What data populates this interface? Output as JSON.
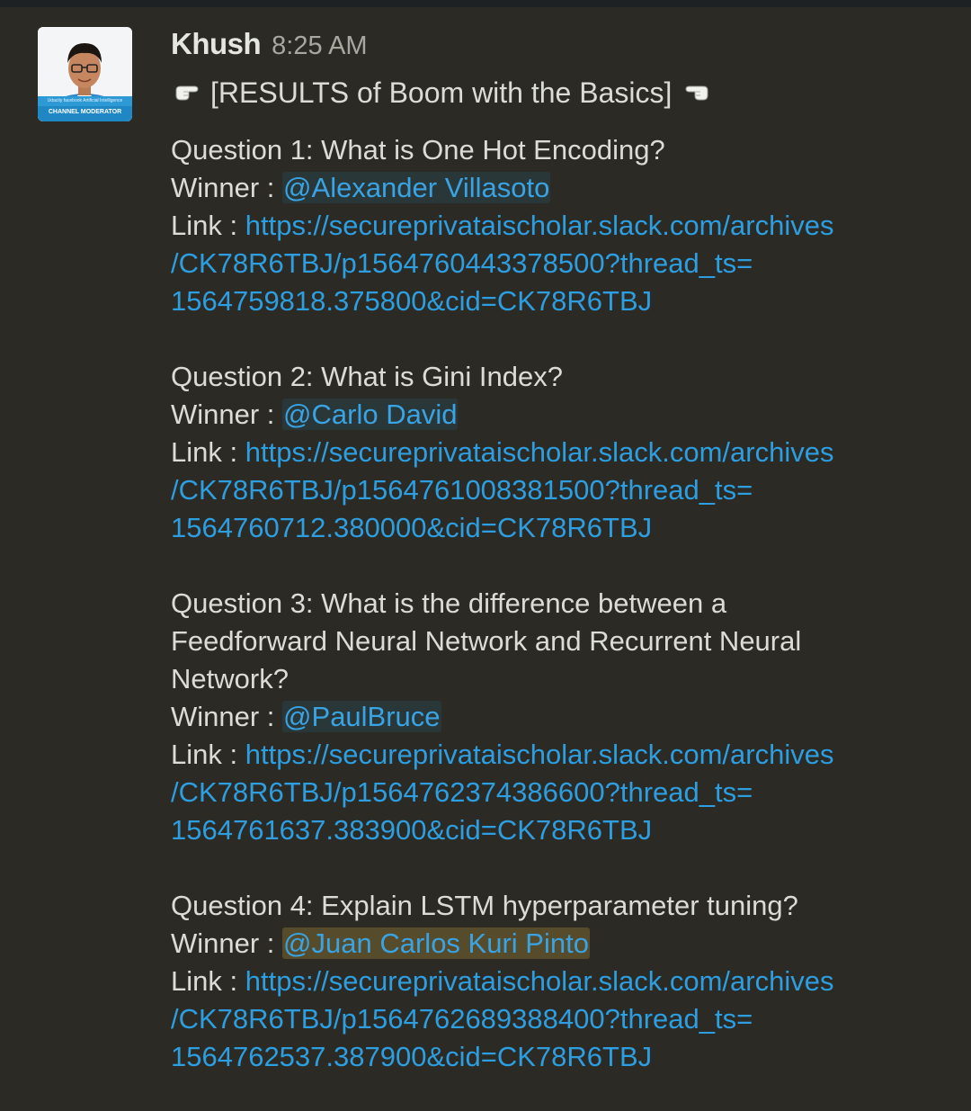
{
  "message": {
    "author": "Khush",
    "timestamp": "8:25 AM",
    "avatar_badge": "CHANNEL MODERATOR",
    "avatar_banner": "Udacity facebook Artificial Intelligence",
    "title": "[RESULTS of Boom with the Basics]",
    "winner_label": "Winner :",
    "link_label": "Link :",
    "questions": [
      {
        "question_line1": "Question 1: What is One Hot Encoding?",
        "question_line2": "",
        "question_line3": "",
        "winner": "@Alexander Villasoto",
        "url_line1": "https://secureprivataischolar.slack.com/archives",
        "url_line2": "/CK78R6TBJ/p1564760443378500?thread_ts=",
        "url_line3": "1564759818.375800&cid=CK78R6TBJ"
      },
      {
        "question_line1": "Question 2: What is Gini Index?",
        "question_line2": "",
        "question_line3": "",
        "winner": "@Carlo David",
        "url_line1": "https://secureprivataischolar.slack.com/archives",
        "url_line2": "/CK78R6TBJ/p1564761008381500?thread_ts=",
        "url_line3": "1564760712.380000&cid=CK78R6TBJ"
      },
      {
        "question_line1": "Question 3: What is the difference between a",
        "question_line2": "Feedforward Neural Network and Recurrent Neural",
        "question_line3": "Network?",
        "winner": "@PaulBruce",
        "url_line1": "https://secureprivataischolar.slack.com/archives",
        "url_line2": "/CK78R6TBJ/p1564762374386600?thread_ts=",
        "url_line3": "1564761637.383900&cid=CK78R6TBJ"
      },
      {
        "question_line1": "Question 4: Explain LSTM hyperparameter tuning?",
        "question_line2": "",
        "question_line3": "",
        "winner": "@Juan Carlos Kuri Pinto",
        "url_line1": "https://secureprivataischolar.slack.com/archives",
        "url_line2": "/CK78R6TBJ/p1564762689388400?thread_ts=",
        "url_line3": "1564762537.387900&cid=CK78R6TBJ"
      }
    ]
  },
  "colors": {
    "background": "#2b2a25",
    "link": "#2d9ee0",
    "mention": "#3aa3e3",
    "self_mention_highlight": "#f2c744"
  }
}
